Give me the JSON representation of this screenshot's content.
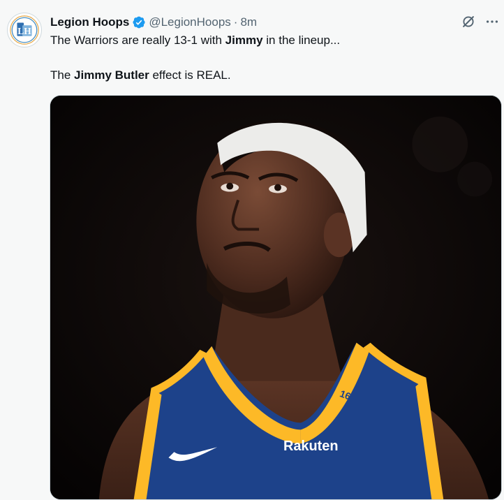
{
  "account": {
    "name": "Legion Hoops",
    "handle": "@LegionHoops",
    "separator": "·",
    "time": "8m",
    "avatar_text": "LH"
  },
  "tweet": {
    "line1_prefix": "The Warriors are really 13-1 with ",
    "line1_bold": "Jimmy",
    "line1_suffix": " in the lineup...",
    "line2_prefix": "The ",
    "line2_bold": "Jimmy Butler",
    "line2_suffix": " effect is REAL."
  },
  "media": {
    "jersey_number": "16",
    "jersey_sponsor": "Rakuten"
  },
  "icons": {
    "verified": "verified-badge-icon",
    "grok": "grok-icon",
    "more": "more-options-icon"
  },
  "colors": {
    "verified": "#1d9bf0",
    "jersey_blue": "#1d428a",
    "jersey_gold": "#fdb927"
  }
}
